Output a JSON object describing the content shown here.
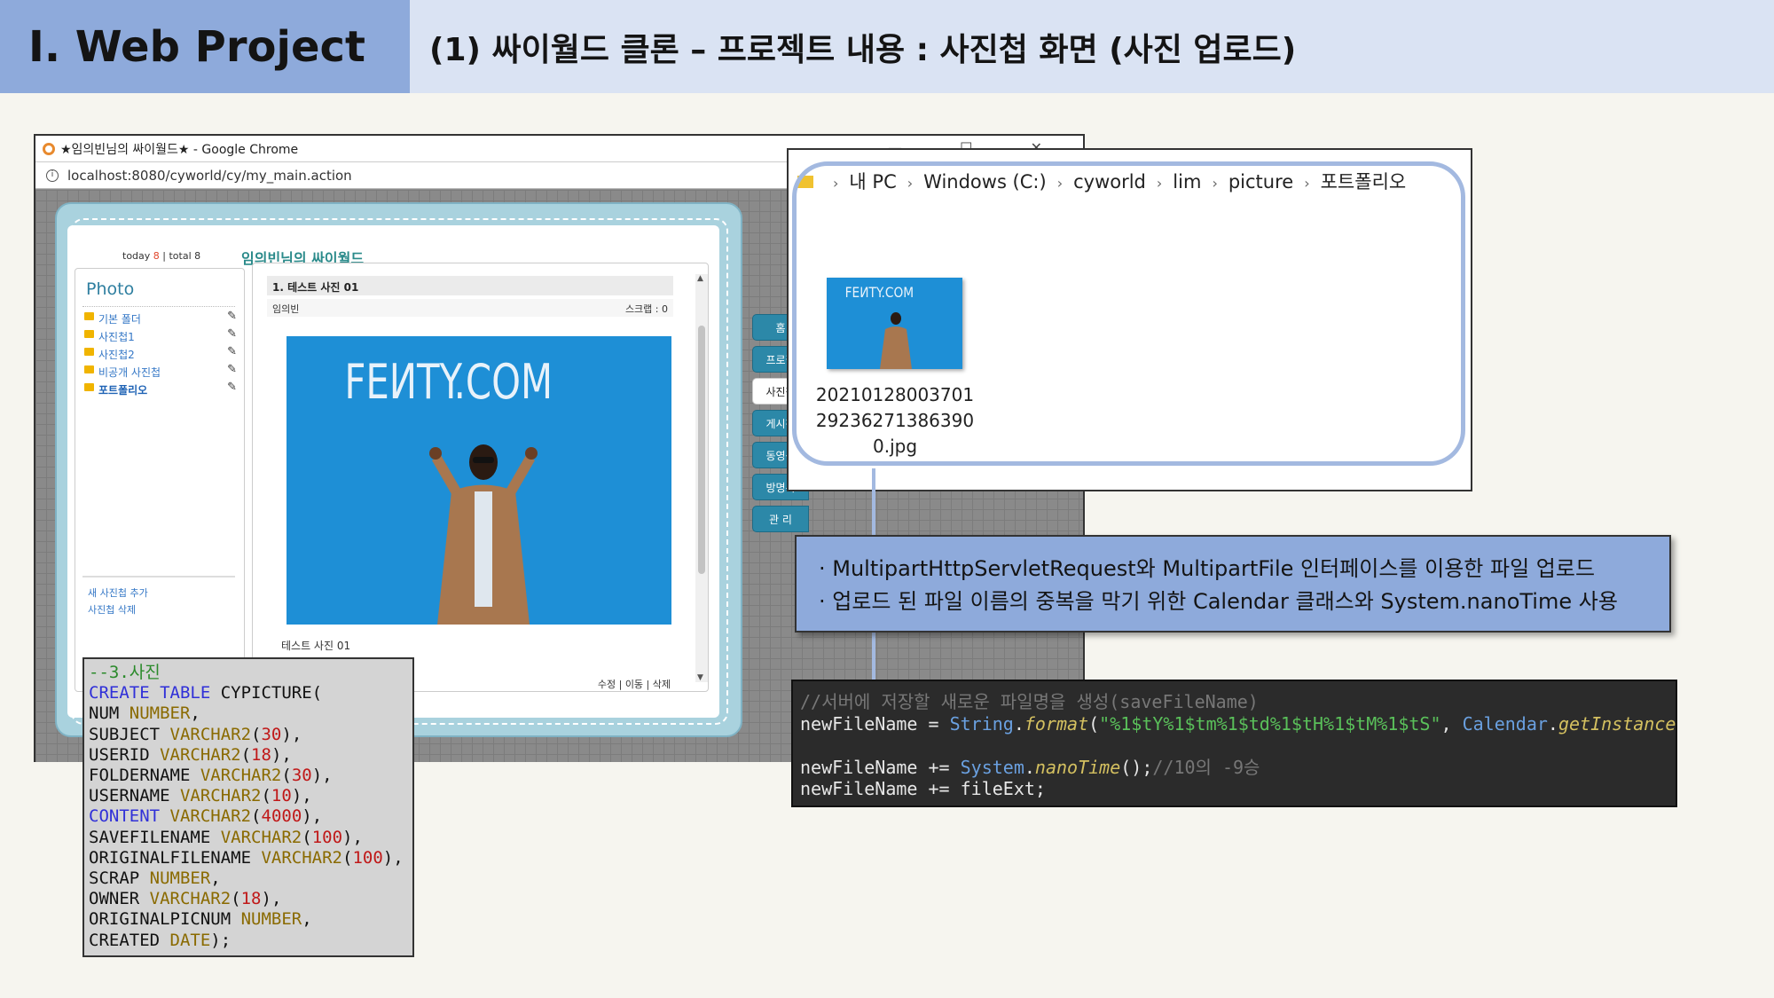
{
  "header": {
    "section": "Ⅰ. Web Project",
    "title": "(1) 싸이월드 클론 – 프로젝트 내용 : 사진첩 화면 (사진 업로드)"
  },
  "browser": {
    "window_title": "★임의빈님의 싸이월드★ - Google Chrome",
    "window_controls": "— ☐ ✕",
    "url": "localhost:8080/cyworld/cy/my_main.action",
    "today_label": "today",
    "today_count": "8",
    "total_label": "| total 8",
    "site_title": "임의빈님의 싸이월드",
    "photo_header": "Photo",
    "folders": [
      "기본 폴더",
      "사진첩1",
      "사진첩2",
      "비공개 사진첩",
      "포트폴리오"
    ],
    "add_album": "새 사진첩 추가",
    "delete_album": "사진첩 삭제",
    "post_title": "1. 테스트 사진 01",
    "post_author": "임의빈",
    "post_scrap": "스크랩 : 0",
    "photo_text": "FEИTY.COM",
    "post_caption": "테스트 사진 01",
    "post_actions": "수정 | 이동 | 삭제",
    "tabs": [
      "홈",
      "프로필",
      "사진첩",
      "게시판",
      "동영상",
      "방명록",
      "관 리"
    ],
    "active_tab": "사진첩"
  },
  "explorer": {
    "path": [
      "내 PC",
      "Windows (C:)",
      "cyworld",
      "lim",
      "picture",
      "포트폴리오"
    ],
    "file_lines": [
      "20210128003701",
      "29236271386390",
      "0.jpg"
    ],
    "thumb_text": "FEИTY.COM"
  },
  "note": {
    "lines": [
      "· MultipartHttpServletRequest와 MultipartFile 인터페이스를 이용한 파일 업로드",
      "· 업로드 된 파일 이름의 중복을 막기 위한 Calendar 클래스와 System.nanoTime 사용"
    ]
  },
  "sql_code": "--3.사진\nCREATE TABLE CYPICTURE(\nNUM NUMBER,\nSUBJECT VARCHAR2(30),\nUSERID VARCHAR2(18),\nFOLDERNAME VARCHAR2(30),\nUSERNAME VARCHAR2(10),\nCONTENT VARCHAR2(4000),\nSAVEFILENAME VARCHAR2(100),\nORIGINALFILENAME VARCHAR2(100),\nSCRAP NUMBER,\nOWNER VARCHAR2(18),\nORIGINALPICNUM NUMBER,\nCREATED DATE);",
  "java_code": "//서버에 저장할 새로운 파일명을 생성(saveFileName)\nnewFileName = String.format(\"%1$tY%1$tm%1$td%1$tH%1$tM%1$tS\", Calendar.getInstance());\n\nnewFileName += System.nanoTime();//10의 -9승\nnewFileName += fileExt;",
  "colors": {
    "header_left": "#8eaadb",
    "header_right": "#dae3f3",
    "tab": "#2c88a8",
    "note": "#8eaadb"
  }
}
